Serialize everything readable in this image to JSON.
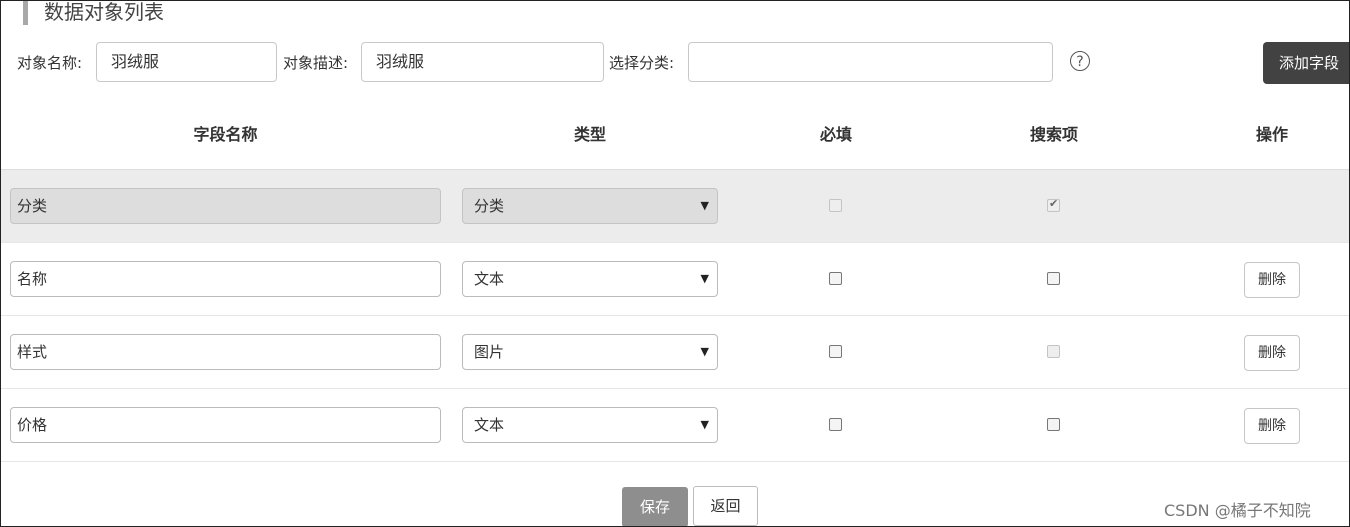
{
  "page": {
    "title": "数据对象列表"
  },
  "filters": {
    "object_name_label": "对象名称:",
    "object_name_value": "羽绒服",
    "object_desc_label": "对象描述:",
    "object_desc_value": "羽绒服",
    "category_label": "选择分类:",
    "category_value": "",
    "help_glyph": "?",
    "add_field_label": "添加字段"
  },
  "table": {
    "headers": [
      "字段名称",
      "类型",
      "必填",
      "搜索项",
      "操作"
    ],
    "rows": [
      {
        "field_name": "分类",
        "type": "分类",
        "required": false,
        "searchable": true,
        "disabled": true,
        "action": ""
      },
      {
        "field_name": "名称",
        "type": "文本",
        "required": false,
        "searchable": false,
        "disabled": false,
        "action": "删除"
      },
      {
        "field_name": "样式",
        "type": "图片",
        "required": false,
        "searchable": false,
        "disabled": false,
        "action": "删除"
      },
      {
        "field_name": "价格",
        "type": "文本",
        "required": false,
        "searchable": false,
        "disabled": false,
        "action": "删除"
      }
    ]
  },
  "footer": {
    "save_label": "保存",
    "back_label": "返回"
  },
  "watermark": "CSDN @橘子不知院",
  "icons": {
    "select_caret": "▼",
    "checkmark": "✔"
  },
  "colors": {
    "add_button_bg": "#424242",
    "save_button_bg": "#8e8e8e",
    "disabled_row_bg": "#ececec"
  }
}
